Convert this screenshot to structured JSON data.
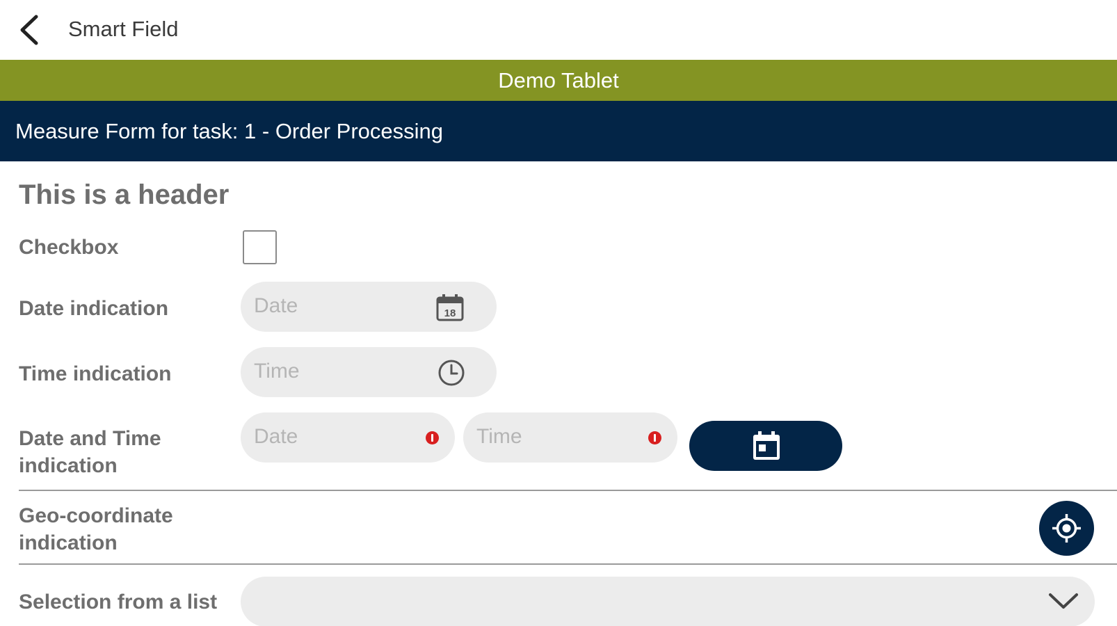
{
  "app_bar": {
    "title": "Smart Field",
    "back_icon": "arrow-back-icon"
  },
  "banner": {
    "text": "Demo Tablet",
    "color": "#849423"
  },
  "form_bar": {
    "title": "Measure Form for task: 1 - Order Processing",
    "color": "#032547"
  },
  "form": {
    "header": "This is a header",
    "checkbox": {
      "label": "Checkbox",
      "checked": false
    },
    "date_indication": {
      "label": "Date indication",
      "placeholder": "Date",
      "icon": "calendar-icon"
    },
    "time_indication": {
      "label": "Time indication",
      "placeholder": "Time",
      "icon": "clock-icon"
    },
    "date_time_indication": {
      "label_line1": "Date and Time",
      "label_line2": "indication",
      "date_placeholder": "Date",
      "time_placeholder": "Time",
      "error_icon": "error-icon",
      "button_icon": "calendar-today-icon"
    },
    "geo_indication": {
      "label_line1": "Geo-coordinate",
      "label_line2": "indication",
      "button_icon": "gps-location-icon"
    },
    "selection": {
      "label": "Selection from a list",
      "value": "",
      "icon": "chevron-down-icon"
    }
  },
  "colors": {
    "accent_green": "#849423",
    "navy": "#032547",
    "error_red": "#d81f1f",
    "field_bg": "#ececec"
  }
}
